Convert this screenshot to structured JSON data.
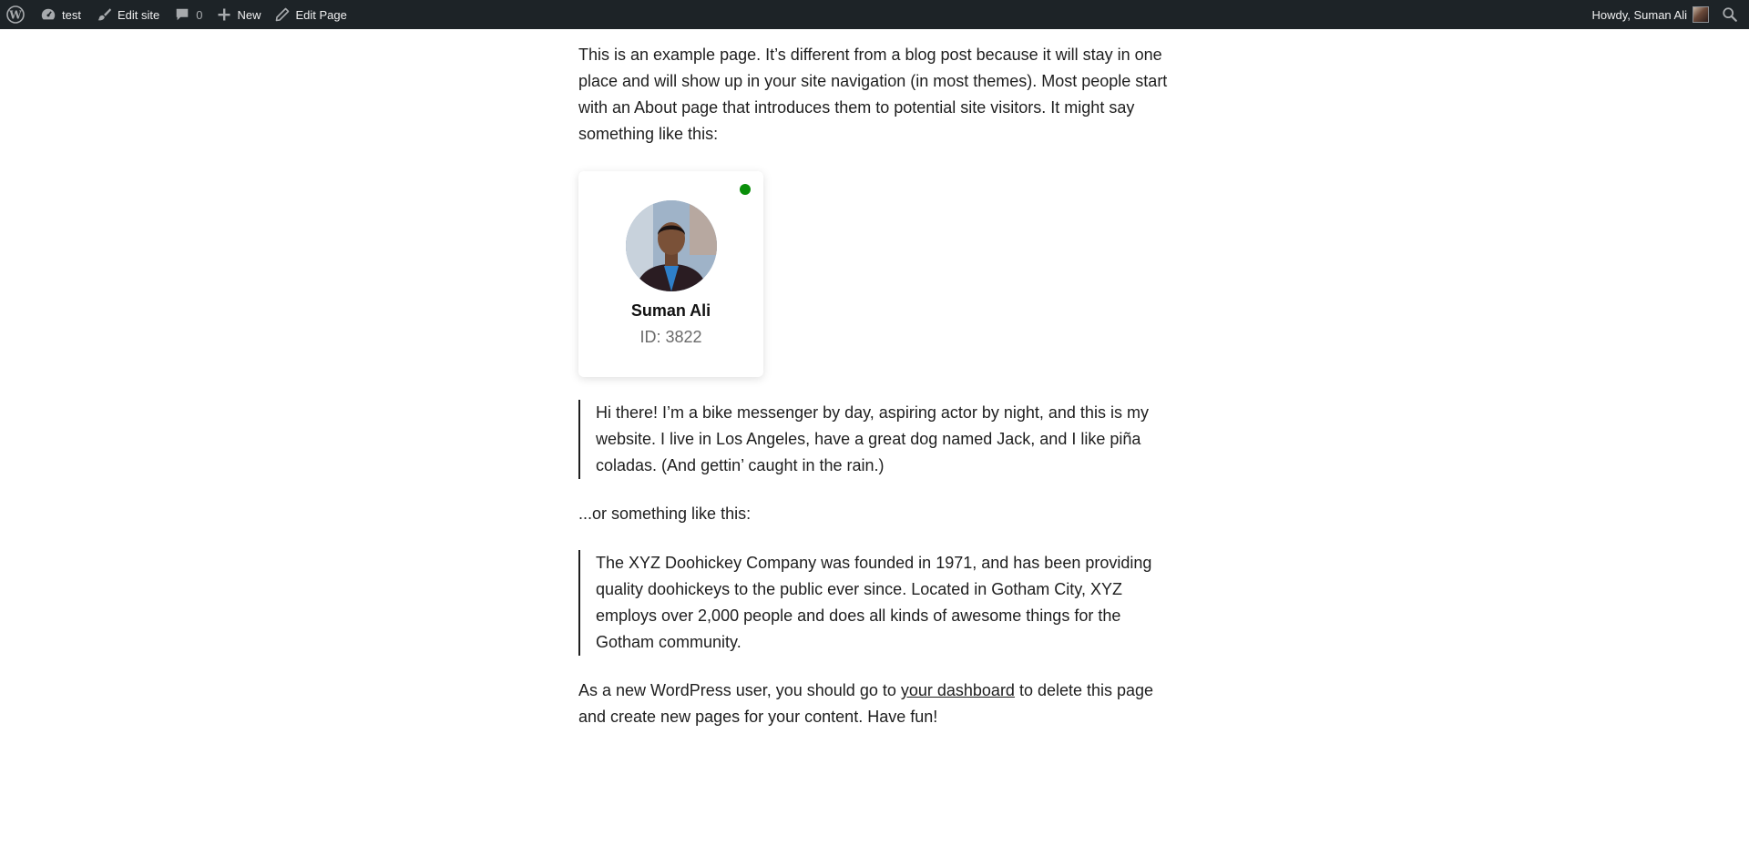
{
  "adminbar": {
    "site_name": "test",
    "edit_site": "Edit site",
    "comments_count": "0",
    "new_label": "New",
    "edit_page": "Edit Page",
    "howdy": "Howdy, Suman Ali",
    "icons": [
      "wordpress-logo-icon",
      "dashboard-icon",
      "brush-icon",
      "comment-icon",
      "plus-icon",
      "pencil-icon",
      "search-icon"
    ]
  },
  "content": {
    "intro": "This is an example page. It’s different from a blog post because it will stay in one place and will show up in your site navigation (in most themes). Most people start with an About page that introduces them to potential site visitors. It might say something like this:",
    "card": {
      "name": "Suman Ali",
      "id": "ID: 3822",
      "status_color": "#0a8f0a"
    },
    "quote1": "Hi there! I’m a bike messenger by day, aspiring actor by night, and this is my website. I live in Los Angeles, have a great dog named Jack, and I like piña coladas. (And gettin’ caught in the rain.)",
    "or_text": "...or something like this:",
    "quote2": "The XYZ Doohickey Company was founded in 1971, and has been providing quality doohickeys to the public ever since. Located in Gotham City, XYZ employs over 2,000 people and does all kinds of awesome things for the Gotham community.",
    "closing_before": "As a new WordPress user, you should go to ",
    "closing_link": "your dashboard",
    "closing_after": " to delete this page and create new pages for your content. Have fun!"
  },
  "colors": {
    "adminbar_bg": "#1d2327",
    "text": "#1e1e1e",
    "muted": "#6a6a6a"
  }
}
